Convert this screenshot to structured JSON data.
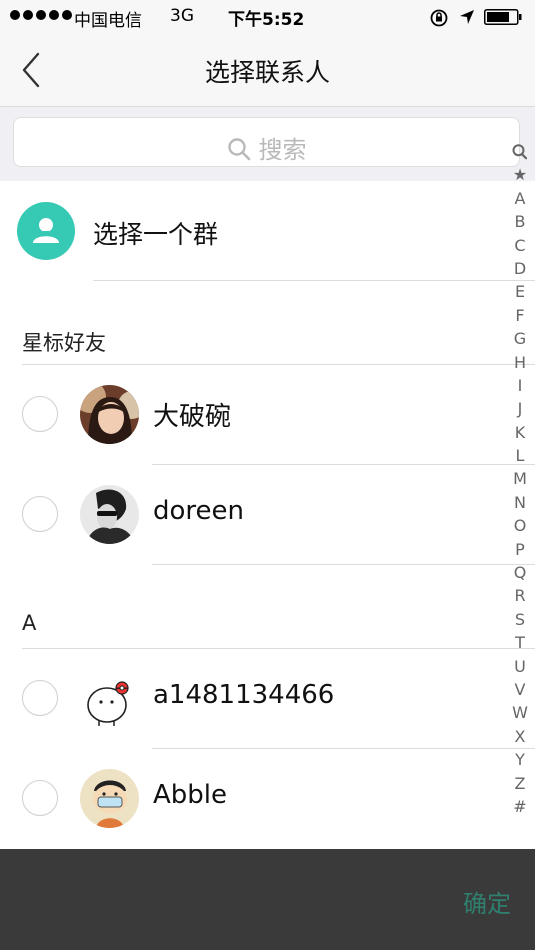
{
  "status_bar": {
    "carrier": "中国电信",
    "network": "3G",
    "time": "下午5:52"
  },
  "nav": {
    "title": "选择联系人"
  },
  "search": {
    "placeholder": "搜索"
  },
  "group": {
    "label": "选择一个群",
    "icon_color": "#36c9b4"
  },
  "sections": [
    {
      "title": "星标好友",
      "contacts": [
        {
          "name": "大破碗",
          "selected": false
        },
        {
          "name": "doreen",
          "selected": false
        }
      ]
    },
    {
      "title": "A",
      "contacts": [
        {
          "name": "a1481134466",
          "selected": false
        },
        {
          "name": "Abble",
          "selected": false
        }
      ]
    }
  ],
  "index_letters": [
    "★",
    "A",
    "B",
    "C",
    "D",
    "E",
    "F",
    "G",
    "H",
    "I",
    "J",
    "K",
    "L",
    "M",
    "N",
    "O",
    "P",
    "Q",
    "R",
    "S",
    "T",
    "U",
    "V",
    "W",
    "X",
    "Y",
    "Z",
    "#"
  ],
  "footer": {
    "confirm_label": "确定",
    "confirm_color": "#2f7f6f"
  }
}
